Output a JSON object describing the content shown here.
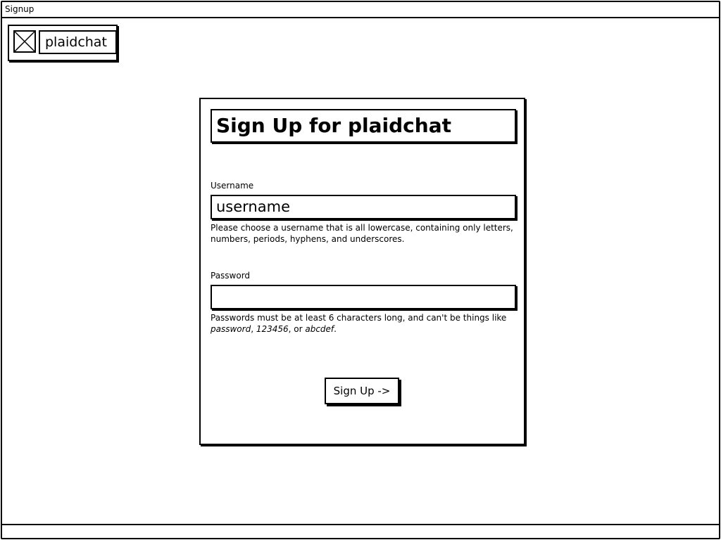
{
  "window": {
    "title": "Signup"
  },
  "logo": {
    "icon": "placeholder-image-icon",
    "name": "plaidchat"
  },
  "form": {
    "heading": "Sign Up for plaidchat",
    "username": {
      "label": "Username",
      "value": "username",
      "help": "Please choose a username that is all lowercase, containing only letters, numbers, periods, hyphens, and underscores."
    },
    "password": {
      "label": "Password",
      "value": "",
      "help_prefix": "Passwords must be at least 6 characters long, and can't be things like ",
      "example_1": "password",
      "sep_1": ", ",
      "example_2": "123456",
      "sep_2": ", or ",
      "example_3": "abcdef",
      "help_suffix": "."
    },
    "submit_label": "Sign Up ->"
  }
}
